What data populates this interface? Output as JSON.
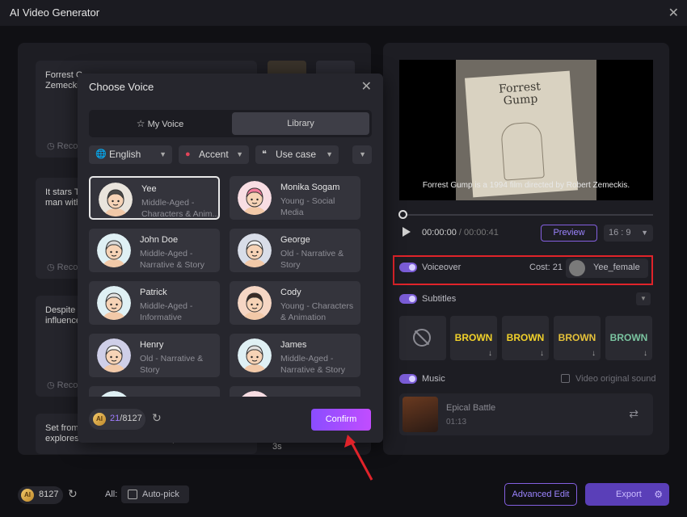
{
  "app": {
    "title": "AI Video Generator"
  },
  "scripts": [
    {
      "text": "Forrest Gump is a 1994 film directed by Robert Zemeckis.",
      "record": "Record"
    },
    {
      "text": "It stars Tom Hanks as a man with...",
      "record": "Record"
    },
    {
      "text": "Despite his limited intellect, Forrest influences...",
      "record": "Record"
    },
    {
      "text": "Set from 1950s to 1980s, the film explores love, war, and friendship."
    }
  ],
  "scripts_visible": [
    {
      "text": "Forrest G\nZemecki",
      "record": "Reco"
    },
    {
      "text": "It stars To\nman with",
      "record": "Reco"
    },
    {
      "text": "Despite h\ninfluence",
      "record": "Reco"
    },
    {
      "text": "Set from\nexplores love, war, and friendship.",
      "record": "Reco"
    }
  ],
  "clip_duration": "3s",
  "video": {
    "poster_title": "Forrest\nGump",
    "caption": "Forrest Gump is a 1994 film directed by Robert Zemeckis.",
    "current_time": "00:00:00",
    "separator": "/",
    "total_time": "00:00:41",
    "preview_label": "Preview",
    "aspect_ratio": "16 : 9"
  },
  "voiceover": {
    "label": "Voiceover",
    "cost": "Cost: 21",
    "voice_name": "Yee_female"
  },
  "subtitles": {
    "label": "Subtitles",
    "styles": [
      {
        "text": "BROWN",
        "color": "#f2d22a",
        "bg": "#1a1a1a"
      },
      {
        "text": "BROWN",
        "color": "#f2d22a",
        "bg": "#2a2a31"
      },
      {
        "text": "BROWN",
        "color": "#e6c23a",
        "bg": "#2a2a31"
      },
      {
        "text": "BROWN",
        "color": "#7ac4a0",
        "bg": "#2a2a31"
      }
    ]
  },
  "music": {
    "label": "Music",
    "original_sound_label": "Video original sound",
    "track_title": "Epical Battle",
    "track_duration": "01:13"
  },
  "bottom": {
    "credits": "8127",
    "all_label": "All:",
    "autopick_label": "Auto-pick",
    "advanced_edit_label": "Advanced Edit",
    "export_label": "Export"
  },
  "modal": {
    "title": "Choose Voice",
    "tab_my_voice": "My Voice",
    "tab_library": "Library",
    "filter_language": "English",
    "filter_accent": "Accent",
    "filter_use_case": "Use case",
    "voices": [
      {
        "name": "Yee",
        "desc": "Middle-Aged - Characters & Anim...",
        "selected": true,
        "avatar_bg": "#e9e4dc",
        "hair": "#4a4a4a"
      },
      {
        "name": "Monika Sogam",
        "desc": "Young - Social Media",
        "selected": false,
        "avatar_bg": "#f8dde3",
        "hair": "#f07a9a"
      },
      {
        "name": "John Doe",
        "desc": "Middle-Aged - Narrative & Story",
        "selected": false,
        "avatar_bg": "#dff0f4",
        "hair": "#d8d8d8"
      },
      {
        "name": "George",
        "desc": "Old - Narrative & Story",
        "selected": false,
        "avatar_bg": "#d8dde8",
        "hair": "#f0f0f0"
      },
      {
        "name": "Patrick",
        "desc": "Middle-Aged - Informative",
        "selected": false,
        "avatar_bg": "#dff0f4",
        "hair": "#e0e0e0"
      },
      {
        "name": "Cody",
        "desc": "Young - Characters & Animation",
        "selected": false,
        "avatar_bg": "#f5d6c4",
        "hair": "#3a2a24"
      },
      {
        "name": "Henry",
        "desc": "Old - Narrative & Story",
        "selected": false,
        "avatar_bg": "#cfcfe8",
        "hair": "#f4f4f4"
      },
      {
        "name": "James",
        "desc": "Middle-Aged - Narrative & Story",
        "selected": false,
        "avatar_bg": "#dff0f4",
        "hair": "#e0e0e0"
      },
      {
        "name": "",
        "desc": "",
        "selected": false,
        "avatar_bg": "#dff0f4",
        "hair": "#e0e0e0"
      },
      {
        "name": "",
        "desc": "",
        "selected": false,
        "avatar_bg": "#f8dde3",
        "hair": "#f07a9a"
      }
    ],
    "credits_used": "21",
    "credits_sep": "/",
    "credits_total": "8127",
    "confirm_label": "Confirm"
  },
  "colors": {
    "accent": "#8a4dff",
    "highlight": "#e0232a",
    "toggle": "#7a5cd6"
  }
}
